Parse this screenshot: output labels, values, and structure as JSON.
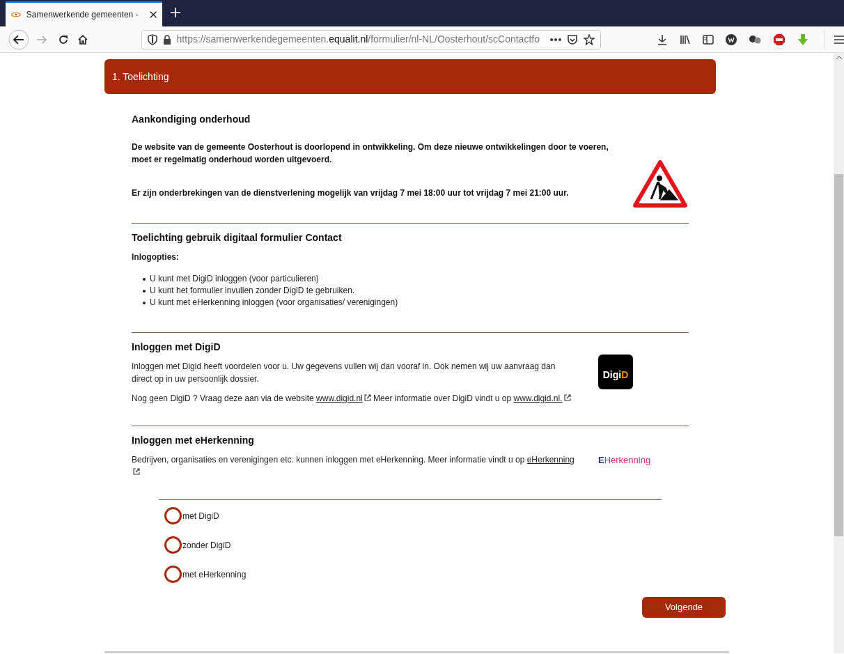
{
  "browser": {
    "tab_title": "Samenwerkende gemeenten - ",
    "url_host_prefix": "https://samenwerkendegemeenten.",
    "url_domain": "equalit.nl",
    "url_path": "/formulier/nl-NL/Oosterhout/scContactfo"
  },
  "step": {
    "title": "1. Toelichting"
  },
  "sections": [
    {
      "kind": "notice",
      "heading": "Aankondiging onderhoud",
      "paragraphs": [
        "De website van de gemeente Oosterhout is doorlopend in ontwikkeling. Om deze nieuwe ontwikkelingen door te voeren, moet er regelmatig onderhoud worden uitgevoerd.",
        "Er zijn onderbrekingen van de dienstverlening mogelijk van vrijdag 7 mei 18:00 uur tot vrijdag 7 mei 21:00 uur."
      ]
    },
    {
      "kind": "list",
      "heading": "Toelichting gebruik digitaal formulier Contact",
      "subheading": "Inlogopties:",
      "items": [
        "U kunt met DigiD inloggen (voor particulieren)",
        "U kunt het formulier invullen zonder DigiD te gebruiken.",
        "U kunt met eHerkenning inloggen (voor organisaties/ verenigingen)"
      ]
    },
    {
      "kind": "digid",
      "heading": "Inloggen met DigiD",
      "logo": [
        "Digi",
        "D"
      ],
      "paragraphs": [
        [
          {
            "text": "Inloggen met Digid heeft voordelen voor u. Uw gegevens vullen wij dan vooraf in. Ook nemen wij uw aanvraag dan direct op in uw persoonlijk dossier."
          }
        ],
        [
          {
            "text": "Nog geen DigiD ? Vraag deze aan via de website "
          },
          {
            "link": "www.digid.nl"
          },
          {
            "text": " Meer informatie over DigiD vindt u op "
          },
          {
            "link": "www.digid.nl."
          }
        ]
      ]
    },
    {
      "kind": "eherkenning",
      "heading": "Inloggen met eHerkenning",
      "logo": [
        "E",
        "Herkenning"
      ],
      "paragraphs": [
        [
          {
            "text": "Bedrijven, organisaties en verenigingen etc. kunnen inloggen met eHerkenning. Meer informatie vindt u op "
          },
          {
            "link": "eHerkenning"
          }
        ]
      ]
    }
  ],
  "options": [
    {
      "label": "met DigiD",
      "selected": false
    },
    {
      "label": "zonder DigiD",
      "selected": false
    },
    {
      "label": "met eHerkenning",
      "selected": false
    }
  ],
  "next_button": "Volgende"
}
